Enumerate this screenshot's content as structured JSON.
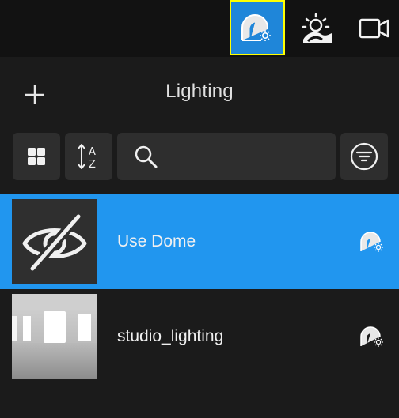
{
  "topbar": {
    "tabs": [
      {
        "icon": "dome-light-icon",
        "active": true
      },
      {
        "icon": "landscape-sun-icon",
        "active": false
      },
      {
        "icon": "video-camera-icon",
        "active": false
      }
    ]
  },
  "panel": {
    "title": "Lighting",
    "search": {
      "placeholder": "",
      "value": ""
    },
    "items": [
      {
        "label": "Use Dome",
        "thumbnail": "eye-off-icon",
        "type_icon": "dome-light-icon",
        "selected": true
      },
      {
        "label": "studio_lighting",
        "thumbnail": "studio-room-image",
        "type_icon": "dome-light-icon",
        "selected": false
      }
    ]
  },
  "colors": {
    "accent": "#2196ef",
    "active_tab": "#1f86d9",
    "highlight_border": "#ffff00",
    "background": "#1b1b1b",
    "topbar": "#121212",
    "control": "#2e2e2e"
  }
}
